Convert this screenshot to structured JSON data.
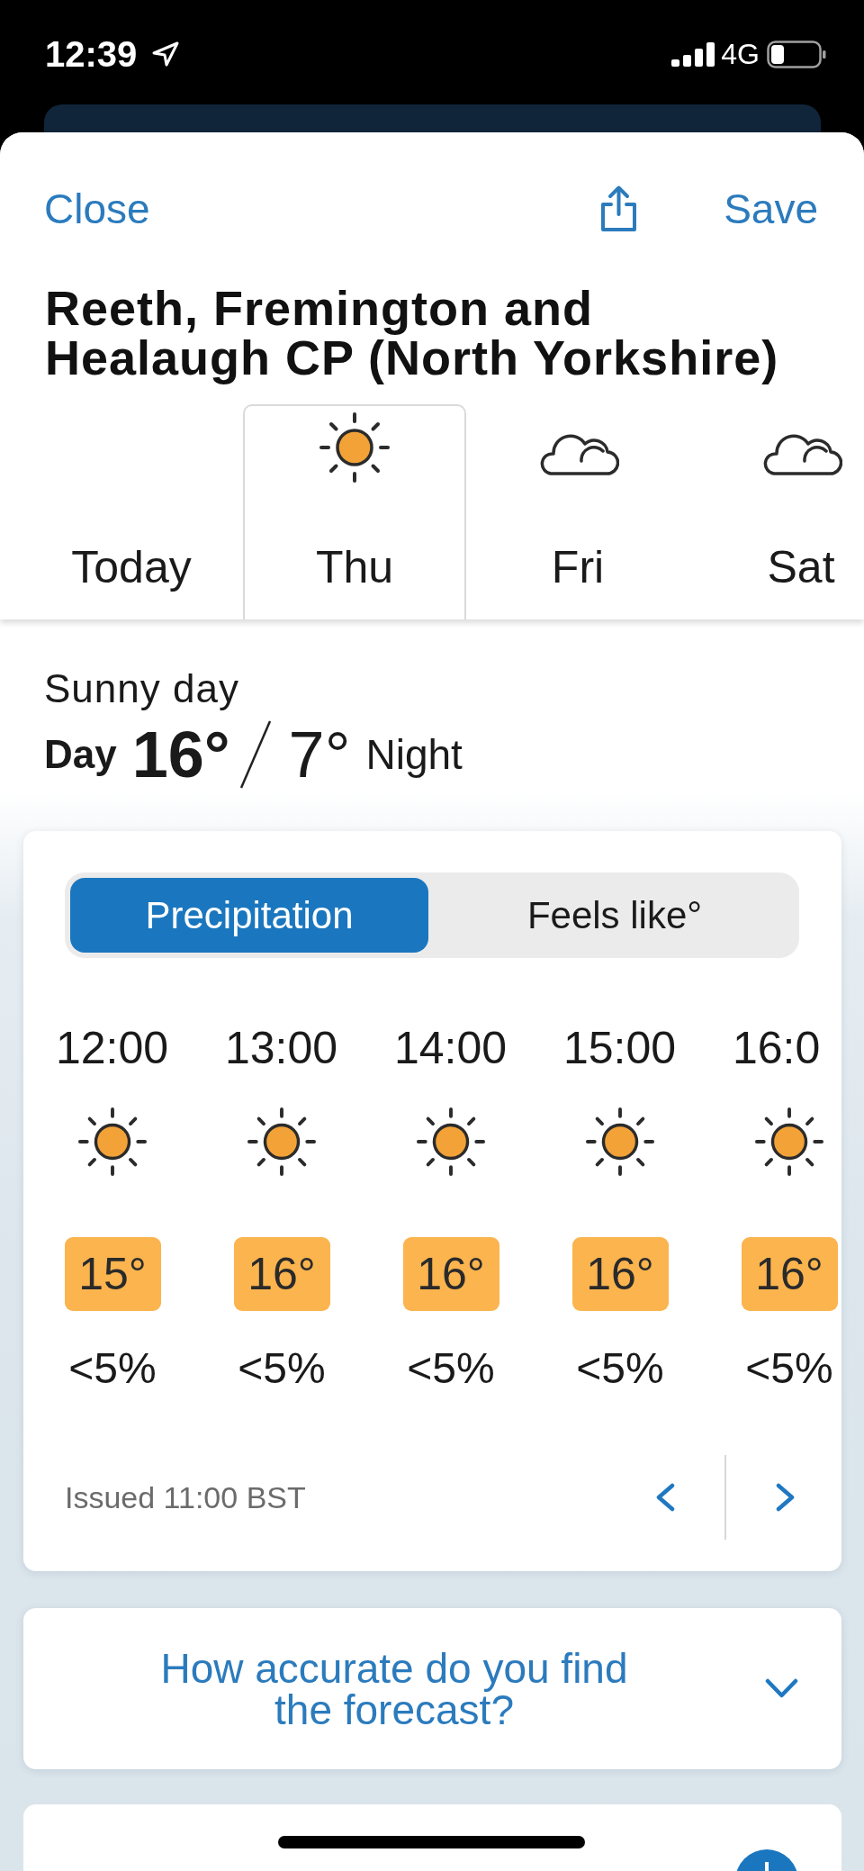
{
  "status_bar": {
    "time": "12:39",
    "network": "4G"
  },
  "header": {
    "close": "Close",
    "save": "Save"
  },
  "location": {
    "title": "Reeth, Fremington and Healaugh CP (North Yorkshire)"
  },
  "days": [
    {
      "label": "Today",
      "kind": "none",
      "selected": false
    },
    {
      "label": "Thu",
      "kind": "sun",
      "selected": true
    },
    {
      "label": "Fri",
      "kind": "cloud",
      "selected": false
    },
    {
      "label": "Sat",
      "kind": "cloud",
      "selected": false
    }
  ],
  "summary": {
    "description": "Sunny day",
    "day_label": "Day",
    "day_temp": "16°",
    "night_temp": "7°",
    "night_label": "Night"
  },
  "forecast": {
    "modes": [
      {
        "label": "Precipitation",
        "selected": true
      },
      {
        "label": "Feels like°",
        "selected": false
      }
    ],
    "hours": [
      {
        "time": "12:00",
        "kind": "sun",
        "temperature": "15°",
        "precipitation": "<5%"
      },
      {
        "time": "13:00",
        "kind": "sun",
        "temperature": "16°",
        "precipitation": "<5%"
      },
      {
        "time": "14:00",
        "kind": "sun",
        "temperature": "16°",
        "precipitation": "<5%"
      },
      {
        "time": "15:00",
        "kind": "sun",
        "temperature": "16°",
        "precipitation": "<5%"
      },
      {
        "time": "16:0",
        "kind": "sun",
        "temperature": "16°",
        "precipitation": "<5%"
      }
    ],
    "issued": "Issued 11:00 BST"
  },
  "feedback": {
    "question": "How accurate do you find the forecast?",
    "expanded": false
  }
}
